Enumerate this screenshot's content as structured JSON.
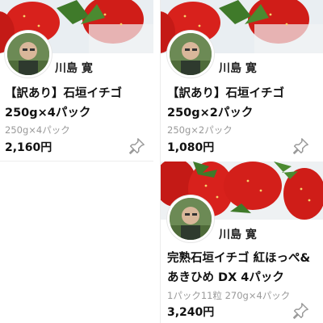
{
  "colors": {
    "photo_bg": "#e9eef2",
    "strawberry": "#d8211c",
    "leaf": "#3f7a2a",
    "muted": "#999999"
  },
  "cards": [
    {
      "seller": "川島 寛",
      "title_lines": [
        "【訳あり】石垣イチゴ",
        "250g×4パック"
      ],
      "desc": "250g×4パック",
      "price": "2,160円",
      "icons": {
        "avatar": "seller-avatar",
        "pin": "pin-icon"
      }
    },
    {
      "seller": "川島 寛",
      "title_lines": [
        "【訳あり】石垣イチゴ",
        "250g×2パック"
      ],
      "desc": "250g×2パック",
      "price": "1,080円",
      "icons": {
        "avatar": "seller-avatar",
        "pin": "pin-icon"
      }
    },
    {
      "seller": "川島 寛",
      "title_lines": [
        "完熟石垣イチゴ 紅ほっぺ&",
        "あきひめ DX 4パック"
      ],
      "desc": "1パック11粒 270g×4パック",
      "price": "3,240円",
      "icons": {
        "avatar": "seller-avatar",
        "pin": "pin-icon"
      }
    }
  ]
}
